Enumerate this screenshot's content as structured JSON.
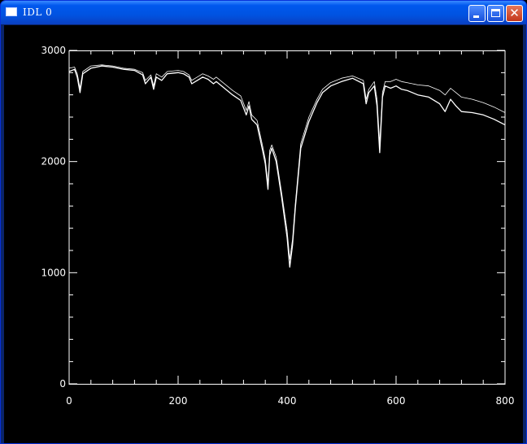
{
  "window": {
    "title": "IDL 0",
    "icons": {
      "app": "window-icon",
      "minimize": "minimize-icon",
      "maximize": "maximize-icon",
      "close": "close-icon"
    },
    "colors": {
      "titlebar": "#0054E3",
      "close_button": "#D5492B",
      "plot_background": "#000000",
      "plot_foreground": "#FFFFFF"
    }
  },
  "chart_data": {
    "type": "line",
    "title": "",
    "xlabel": "",
    "ylabel": "",
    "xlim": [
      0,
      800
    ],
    "ylim": [
      0,
      3000
    ],
    "x_ticks": [
      0,
      200,
      400,
      600,
      800
    ],
    "y_ticks": [
      0,
      1000,
      2000,
      3000
    ],
    "grid": false,
    "legend": "none",
    "series": [
      {
        "x": [
          0,
          10,
          15,
          20,
          25,
          40,
          60,
          80,
          100,
          120,
          135,
          140,
          150,
          155,
          160,
          170,
          180,
          200,
          210,
          220,
          225,
          235,
          245,
          255,
          265,
          270,
          280,
          300,
          315,
          325,
          330,
          335,
          345,
          355,
          360,
          365,
          368,
          372,
          380,
          390,
          400,
          405,
          410,
          415,
          425,
          440,
          455,
          465,
          480,
          500,
          520,
          540,
          545,
          550,
          560,
          565,
          570,
          575,
          580,
          590,
          600,
          610,
          620,
          640,
          660,
          680,
          690,
          700,
          710,
          720,
          740,
          760,
          780,
          800
        ],
        "y": [
          2810,
          2830,
          2760,
          2620,
          2790,
          2840,
          2860,
          2850,
          2830,
          2820,
          2780,
          2700,
          2760,
          2650,
          2760,
          2730,
          2790,
          2800,
          2790,
          2760,
          2700,
          2730,
          2760,
          2740,
          2700,
          2720,
          2680,
          2600,
          2550,
          2420,
          2500,
          2380,
          2330,
          2100,
          1980,
          1750,
          2060,
          2120,
          2000,
          1680,
          1320,
          1050,
          1250,
          1580,
          2120,
          2360,
          2530,
          2620,
          2680,
          2720,
          2750,
          2700,
          2520,
          2620,
          2680,
          2500,
          2080,
          2580,
          2680,
          2660,
          2680,
          2650,
          2640,
          2600,
          2580,
          2520,
          2450,
          2560,
          2500,
          2450,
          2440,
          2420,
          2380,
          2330
        ]
      },
      {
        "x": [
          0,
          10,
          15,
          20,
          25,
          40,
          60,
          80,
          100,
          120,
          135,
          140,
          150,
          155,
          160,
          170,
          180,
          200,
          210,
          220,
          225,
          235,
          245,
          255,
          265,
          270,
          280,
          300,
          315,
          325,
          330,
          335,
          345,
          355,
          360,
          365,
          368,
          372,
          380,
          390,
          400,
          405,
          410,
          415,
          425,
          440,
          455,
          465,
          480,
          500,
          520,
          540,
          545,
          550,
          560,
          565,
          570,
          575,
          580,
          590,
          600,
          610,
          620,
          640,
          660,
          680,
          690,
          700,
          710,
          720,
          740,
          760,
          780,
          800
        ],
        "y": [
          2840,
          2850,
          2790,
          2660,
          2810,
          2860,
          2870,
          2860,
          2840,
          2830,
          2800,
          2730,
          2780,
          2680,
          2790,
          2760,
          2810,
          2820,
          2810,
          2780,
          2730,
          2760,
          2790,
          2770,
          2740,
          2760,
          2720,
          2640,
          2590,
          2460,
          2540,
          2420,
          2370,
          2140,
          2020,
          1800,
          2100,
          2150,
          2040,
          1720,
          1380,
          1120,
          1300,
          1620,
          2160,
          2400,
          2560,
          2650,
          2710,
          2750,
          2770,
          2730,
          2560,
          2650,
          2720,
          2560,
          2160,
          2620,
          2720,
          2720,
          2740,
          2720,
          2710,
          2690,
          2680,
          2640,
          2600,
          2660,
          2620,
          2580,
          2560,
          2530,
          2490,
          2440
        ]
      }
    ]
  }
}
